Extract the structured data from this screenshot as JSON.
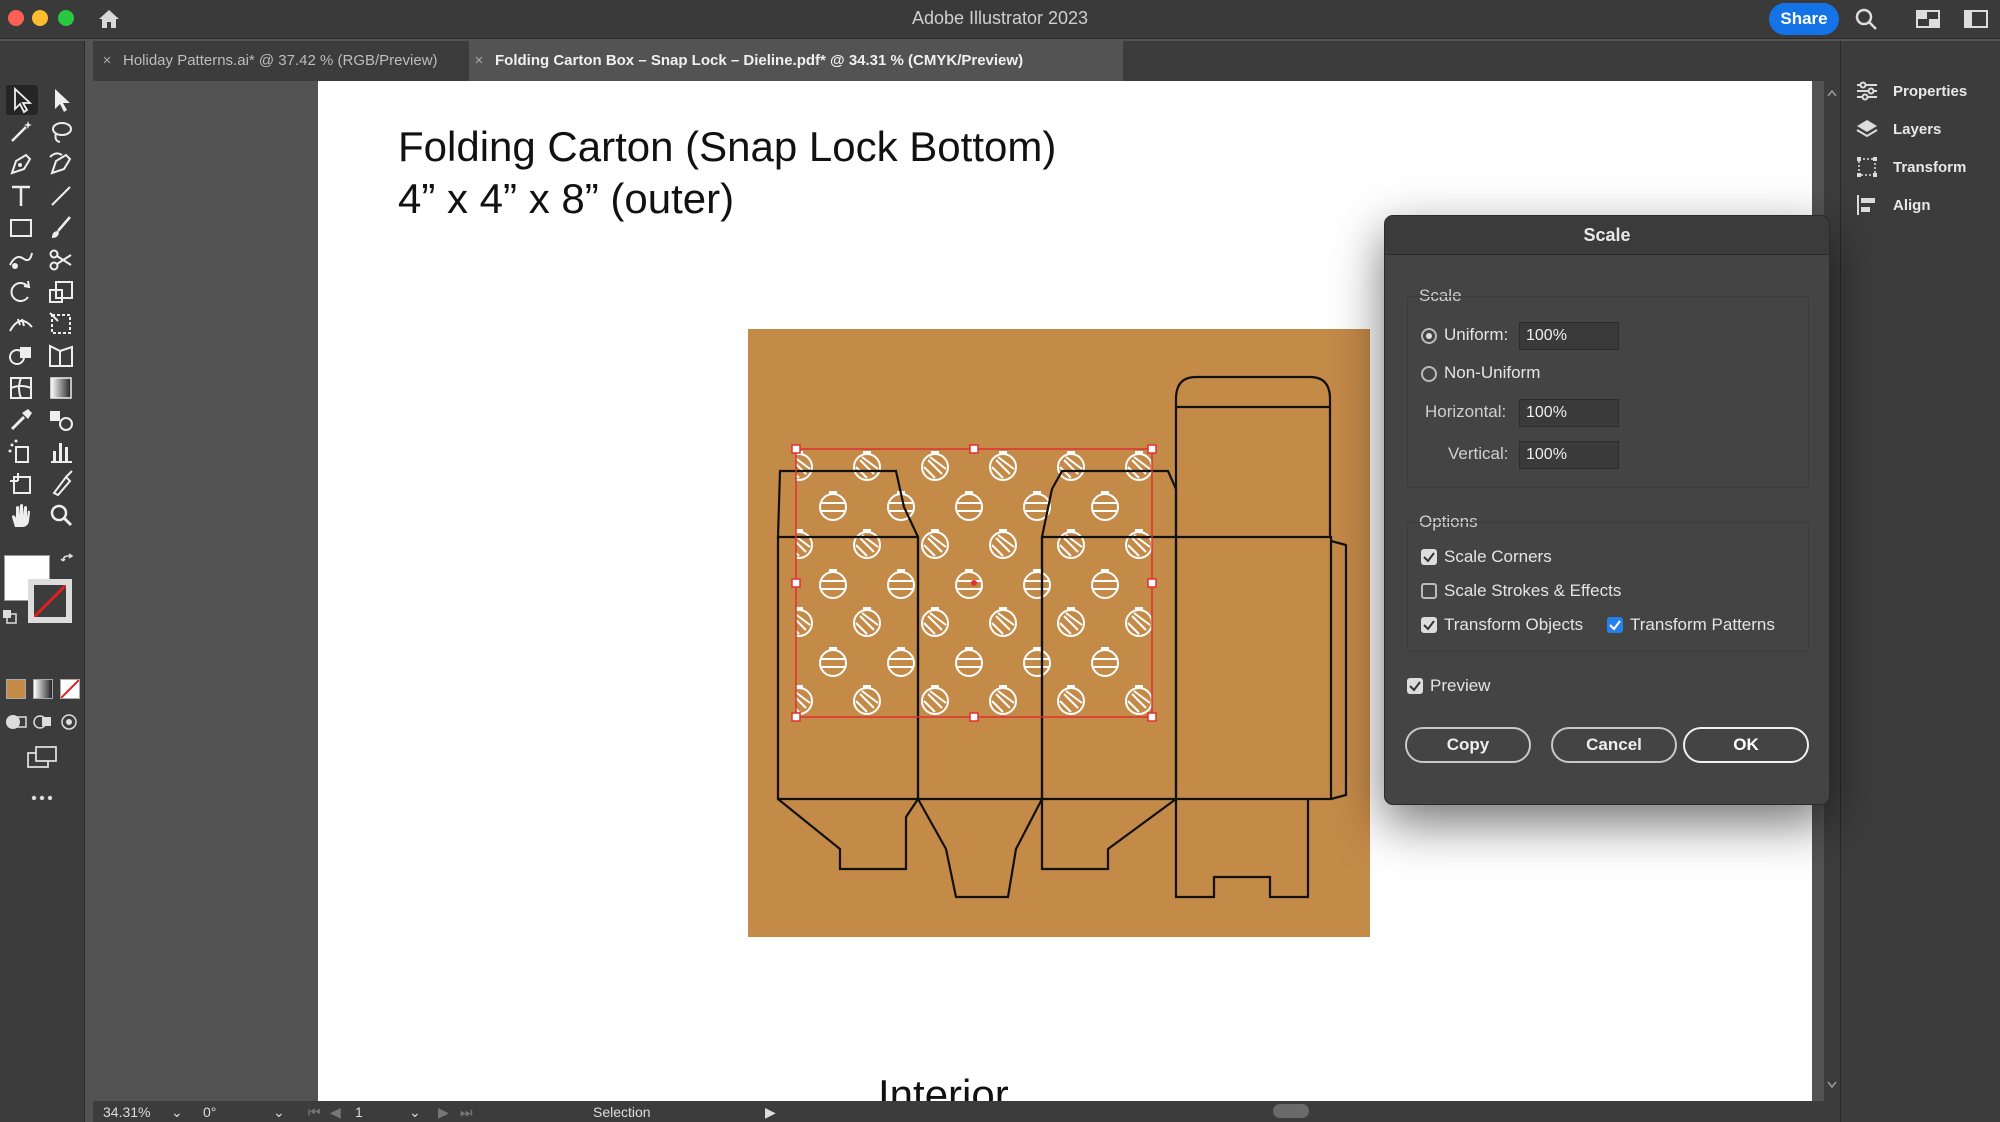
{
  "app": {
    "title": "Adobe Illustrator 2023",
    "share_label": "Share"
  },
  "tabs": [
    {
      "label": "Holiday Patterns.ai* @ 37.42 % (RGB/Preview)",
      "close": "×"
    },
    {
      "label": "Folding Carton Box – Snap Lock – Dieline.pdf* @ 34.31 % (CMYK/Preview)",
      "close": "×"
    }
  ],
  "artboard": {
    "title_line1": "Folding Carton (Snap Lock Bottom)",
    "title_line2": "4” x 4” x 8” (outer)",
    "interior_label": "Interior",
    "background_color": "#c48a48"
  },
  "right_panel": {
    "items": [
      {
        "label": "Properties",
        "icon": "properties-icon"
      },
      {
        "label": "Layers",
        "icon": "layers-icon"
      },
      {
        "label": "Transform",
        "icon": "transform-icon"
      },
      {
        "label": "Align",
        "icon": "align-icon"
      }
    ]
  },
  "status": {
    "zoom": "34.31%",
    "rotation": "0°",
    "artboard_number": "1",
    "mode": "Selection"
  },
  "dialog": {
    "title": "Scale",
    "scale_group_label": "Scale",
    "uniform_label": "Uniform:",
    "uniform_value": "100%",
    "nonuniform_label": "Non-Uniform",
    "horizontal_label": "Horizontal:",
    "horizontal_value": "100%",
    "vertical_label": "Vertical:",
    "vertical_value": "100%",
    "options_group_label": "Options",
    "scale_corners_label": "Scale Corners",
    "scale_strokes_label": "Scale Strokes & Effects",
    "transform_objects_label": "Transform Objects",
    "transform_patterns_label": "Transform Patterns",
    "preview_label": "Preview",
    "copy_label": "Copy",
    "cancel_label": "Cancel",
    "ok_label": "OK",
    "selected_option": "Uniform",
    "checked": {
      "scale_corners": true,
      "scale_strokes": false,
      "transform_objects": true,
      "transform_patterns": true,
      "preview": true
    }
  },
  "colors": {
    "accent": "#1473e6",
    "selection": "#e03030",
    "carton_fill": "#c48a48"
  }
}
